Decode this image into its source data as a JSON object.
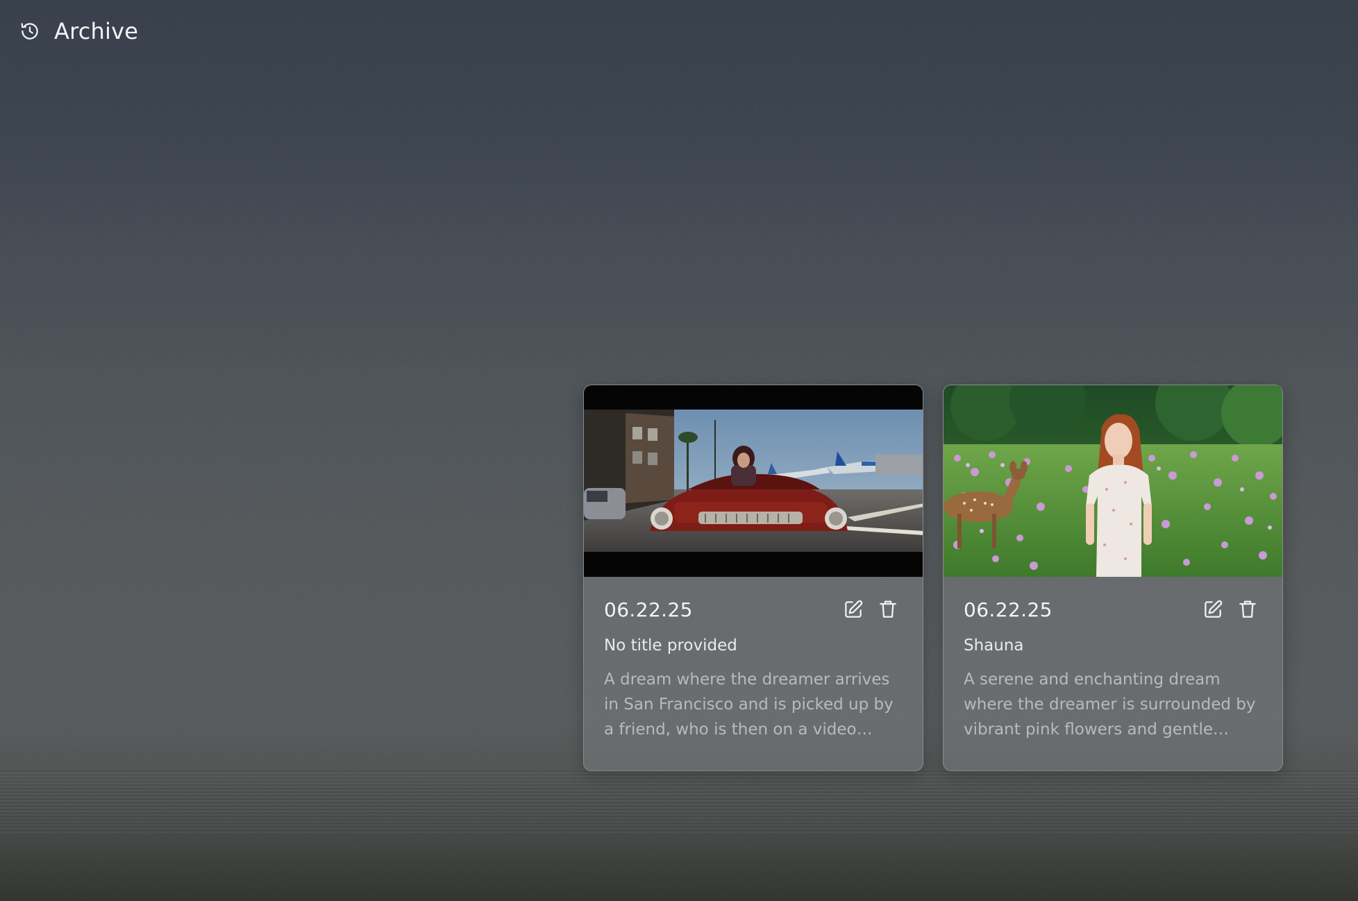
{
  "header": {
    "title": "Archive",
    "icon": "history-icon"
  },
  "cards": [
    {
      "date": "06.22.25",
      "title": "No title provided",
      "description": "A dream where the dreamer arrives in San Francisco and is picked up by a friend, who is then on a video call...",
      "edit_icon": "edit-icon",
      "delete_icon": "trash-icon"
    },
    {
      "date": "06.22.25",
      "title": "Shauna",
      "description": "A serene and enchanting dream where the dreamer is surrounded by vibrant pink flowers and gentle dee...",
      "edit_icon": "edit-icon",
      "delete_icon": "trash-icon"
    }
  ]
}
